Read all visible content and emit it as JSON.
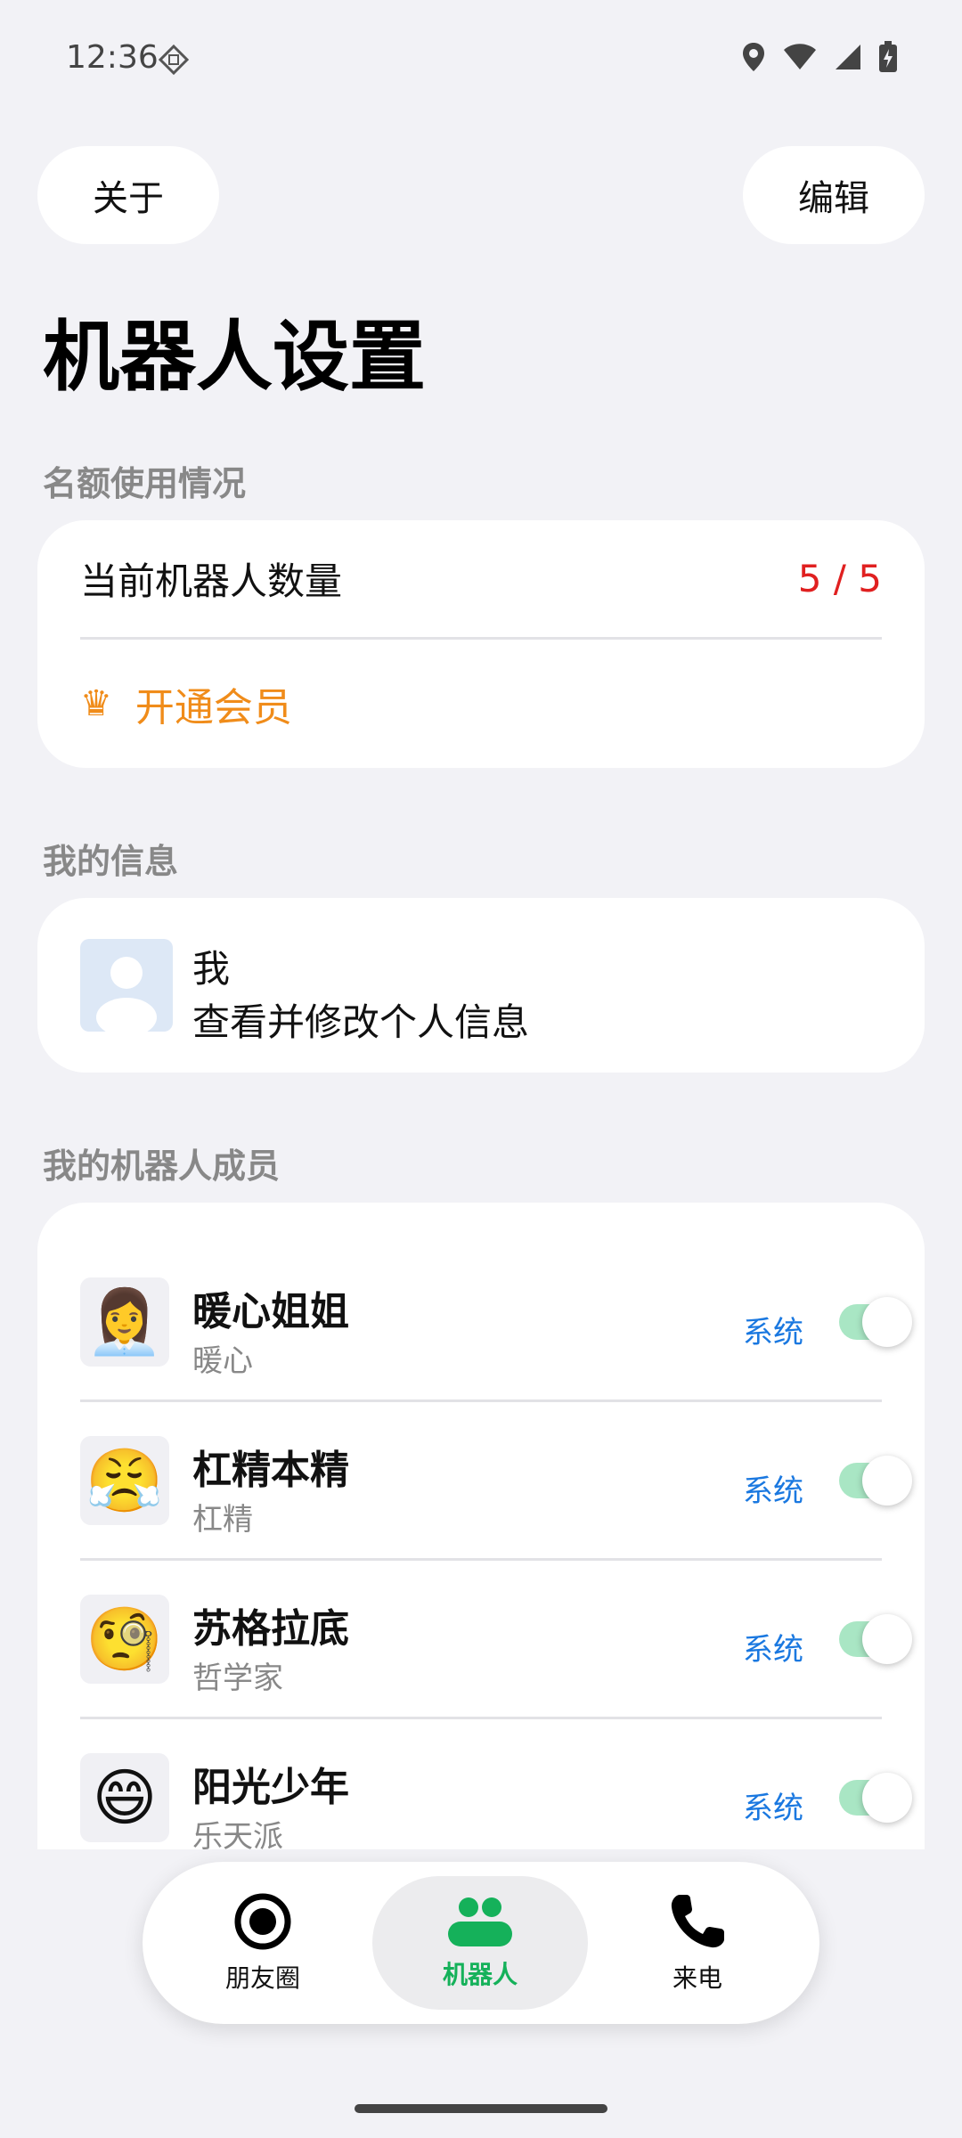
{
  "status_bar": {
    "time": "12:36"
  },
  "header": {
    "about_label": "关于",
    "edit_label": "编辑",
    "title": "机器人设置"
  },
  "quota": {
    "section_label": "名额使用情况",
    "count_label": "当前机器人数量",
    "count_value": "5 / 5",
    "vip_label": "开通会员",
    "vip_icon": "crown-icon"
  },
  "me": {
    "section_label": "我的信息",
    "name": "我",
    "description": "查看并修改个人信息"
  },
  "members": {
    "section_label": "我的机器人成员",
    "items": [
      {
        "name": "暖心姐姐",
        "desc": "暖心",
        "tag": "系统",
        "emoji": "👩‍💼",
        "enabled": true
      },
      {
        "name": "杠精本精",
        "desc": "杠精",
        "tag": "系统",
        "emoji": "😤",
        "enabled": true
      },
      {
        "name": "苏格拉底",
        "desc": "哲学家",
        "tag": "系统",
        "emoji": "🧐",
        "enabled": true
      },
      {
        "name": "阳光少年",
        "desc": "乐天派",
        "tag": "系统",
        "emoji": "😄",
        "enabled": true
      }
    ]
  },
  "bottom_nav": {
    "items": [
      {
        "label": "朋友圈",
        "icon": "moments-icon"
      },
      {
        "label": "机器人",
        "icon": "robots-icon",
        "active": true
      },
      {
        "label": "来电",
        "icon": "phone-icon"
      }
    ],
    "active_color": "#15b15a"
  },
  "colors": {
    "accent_orange": "#f08c1a",
    "quota_red": "#e02020",
    "tag_blue": "#1a78e0",
    "toggle_on": "#a9e6c4"
  }
}
